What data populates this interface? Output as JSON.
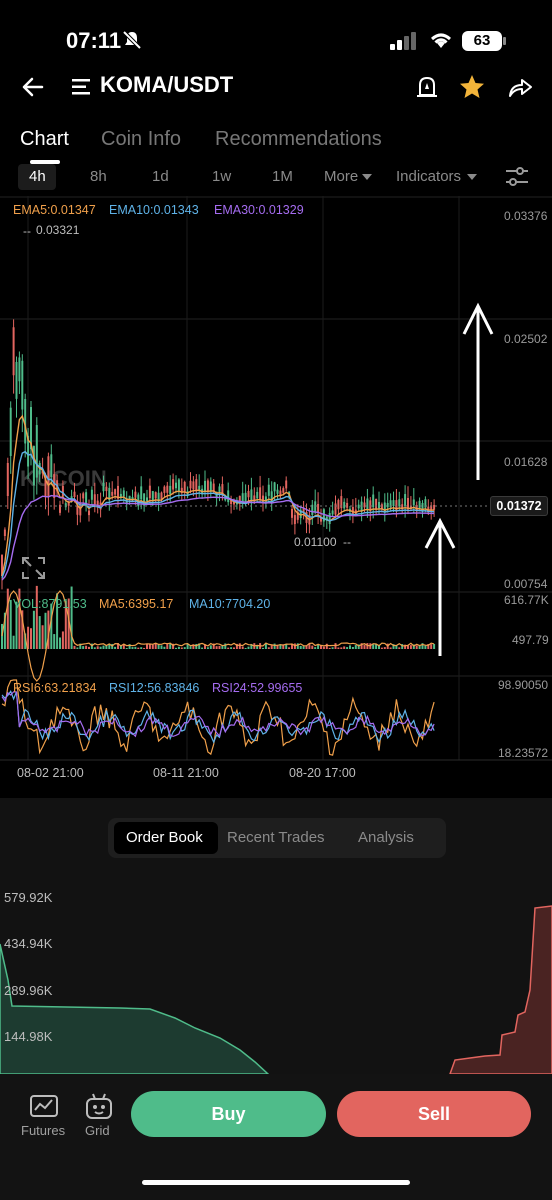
{
  "status": {
    "time": "07:11",
    "battery": "63"
  },
  "header": {
    "pair": "KOMA/USDT"
  },
  "tabs": [
    "Chart",
    "Coin Info",
    "Recommendations"
  ],
  "timeframes": [
    "4h",
    "8h",
    "1d",
    "1w",
    "1M",
    "More",
    "Indicators"
  ],
  "chart": {
    "ema": {
      "ema5": "EMA5:0.01347",
      "ema10": "EMA10:0.01343",
      "ema30": "EMA30:0.01329"
    },
    "price_axis": [
      "0.03376",
      "0.02502",
      "0.01628",
      "0.00754"
    ],
    "current_price": "0.01372",
    "high_marker": "0.03321",
    "low_marker": "0.01100",
    "watermark": "KUCOIN",
    "volume": {
      "vol": "VOL:8791.53",
      "ma5": "MA5:6395.17",
      "ma10": "MA10:7704.20",
      "axis_top": "616.77K",
      "axis_bottom": "497.79"
    },
    "rsi": {
      "rsi6": "RSI6:63.21834",
      "rsi12": "RSI12:56.83846",
      "rsi24": "RSI24:52.99655",
      "axis_top": "98.90050",
      "axis_bottom": "18.23572"
    },
    "x_axis": [
      "08-02 21:00",
      "08-11 21:00",
      "08-20 17:00"
    ],
    "colors": {
      "ema5": "#f0a04b",
      "ema10": "#5fb3e8",
      "ema30": "#a56cf0",
      "up": "#4fbc8a",
      "down": "#e2655f"
    }
  },
  "orderbook_tabs": [
    "Order Book",
    "Recent Trades",
    "Analysis"
  ],
  "depth_axis": [
    "579.92K",
    "434.94K",
    "289.96K",
    "144.98K"
  ],
  "footer": {
    "futures": "Futures",
    "grid": "Grid",
    "buy": "Buy",
    "sell": "Sell"
  }
}
